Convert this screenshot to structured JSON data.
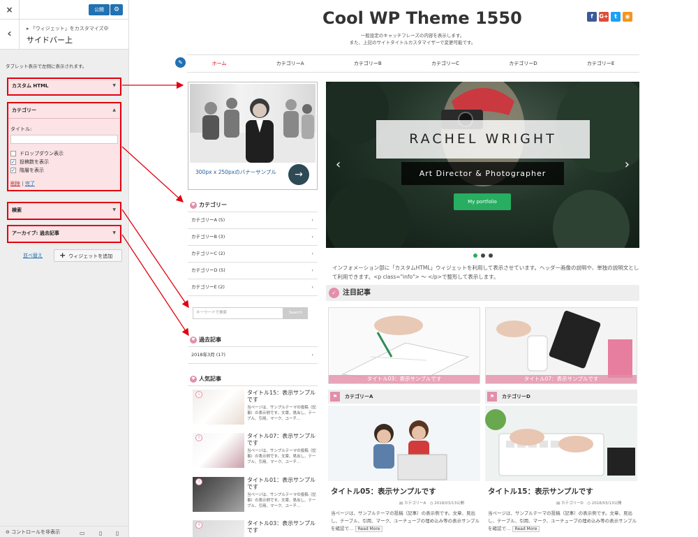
{
  "customizer": {
    "close_icon": "×",
    "publish_label": "公開",
    "back_icon": "‹",
    "breadcrumb": "「ウィジェット」をカスタマイズ中",
    "title": "サイドバー上",
    "description": "タブレット表示で左側に表示されます。",
    "widgets": [
      {
        "label": "カスタム HTML",
        "toggle": "▼"
      },
      {
        "label": "カテゴリー",
        "toggle": "▲"
      },
      {
        "label": "検索",
        "toggle": "▼"
      },
      {
        "label": "アーカイブ: 過去記事",
        "toggle": "▼"
      }
    ],
    "category_form": {
      "title_label": "タイトル:",
      "title_value": "",
      "checkboxes": [
        {
          "label": "ドロップダウン表示",
          "checked": false
        },
        {
          "label": "投稿数を表示",
          "checked": true
        },
        {
          "label": "階層を表示",
          "checked": true
        }
      ],
      "delete_label": "削除",
      "separator": "|",
      "done_label": "完了"
    },
    "reorder_label": "並べ替え",
    "add_widget_label": "ウィジェットを追加",
    "footer_label": "コントロールを非表示"
  },
  "site": {
    "title": "Cool WP Theme 1550",
    "tagline_1": "一般設定のキャッチフレーズの内容を表示します。",
    "tagline_2": "また、上記のサイトタイトルカスタマイザーで変更可能です。",
    "social": [
      {
        "name": "facebook-icon",
        "glyph": "f",
        "color": "#3b5998"
      },
      {
        "name": "google-plus-icon",
        "glyph": "G+",
        "color": "#dd4b39"
      },
      {
        "name": "twitter-icon",
        "glyph": "t",
        "color": "#1da1f2"
      },
      {
        "name": "rss-icon",
        "glyph": "◉",
        "color": "#f7941d"
      }
    ],
    "nav": [
      "ホーム",
      "カテゴリーA",
      "カテゴリーB",
      "カテゴリーC",
      "カテゴリーD",
      "カテゴリーE"
    ]
  },
  "sidebar": {
    "banner_caption": "300px x 250pxのバナーサンプル",
    "banner_button": "→",
    "category_title": "カテゴリー",
    "categories": [
      "カテゴリーA (5)",
      "カテゴリーB (3)",
      "カテゴリーC (2)",
      "カテゴリーD (5)",
      "カテゴリーE (2)"
    ],
    "search_placeholder": "キーワードで検索",
    "search_button": "Search",
    "archive_title": "過去記事",
    "archives": [
      "2018年3月 (17)"
    ],
    "popular_title": "人気記事",
    "popular": [
      {
        "rank": "1",
        "title": "タイトル15：表示サンプルです",
        "excerpt": "当ページは、サンプルテーマの投稿（記事）の表示例です。文章、見出し、テーブル、引用、マーク、ユーチ…"
      },
      {
        "rank": "2",
        "title": "タイトル07：表示サンプルです",
        "excerpt": "当ページは、サンプルテーマの投稿（記事）の表示例です。文章、見出し、テーブル、引用、マーク、ユーチ…"
      },
      {
        "rank": "3",
        "title": "タイトル01：表示サンプルです",
        "excerpt": "当ページは、サンプルテーマの投稿（記事）の表示例です。文章、見出し、テーブル、引用、マーク、ユーチ…"
      },
      {
        "rank": "4",
        "title": "タイトル03：表示サンプルです",
        "excerpt": ""
      }
    ]
  },
  "slider": {
    "name": "RACHEL WRIGHT",
    "role": "Art Director & Photographer",
    "button": "My portfolio",
    "prev": "‹",
    "next": "›"
  },
  "info_text": "インフォメーション部に「カスタムHTML」ウィジェットを利用して表示させています。ヘッダー画像の説明や、単独の説明文として利用できます。<p class=\"info\"> 〜 </p>で整形して表示します。",
  "featured": {
    "title": "注目記事",
    "cards": [
      "タイトル03：表示サンプルです",
      "タイトル07：表示サンプルです"
    ]
  },
  "posts": [
    {
      "category": "カテゴリーA",
      "title": "タイトル05：表示サンプルです",
      "meta_cat": "カテゴリーA",
      "date": "2018/03/13公開",
      "excerpt": "当ページは、サンプルテーマの投稿（記事）の表示例です。文章、見出し、テーブル、引用、マーク、ユーチューブの埋め込み等の表示サンプルを確認で…",
      "more": "Read More"
    },
    {
      "category": "カテゴリーD",
      "title": "タイトル15：表示サンプルです",
      "meta_cat": "カテゴリーD",
      "date": "2018/03/13公開",
      "excerpt": "当ページは、サンプルテーマの投稿（記事）の表示例です。文章、見出し、テーブル、引用、マーク、ユーチューブの埋め込み等の表示サンプルを確認で…",
      "more": "Read More"
    }
  ]
}
